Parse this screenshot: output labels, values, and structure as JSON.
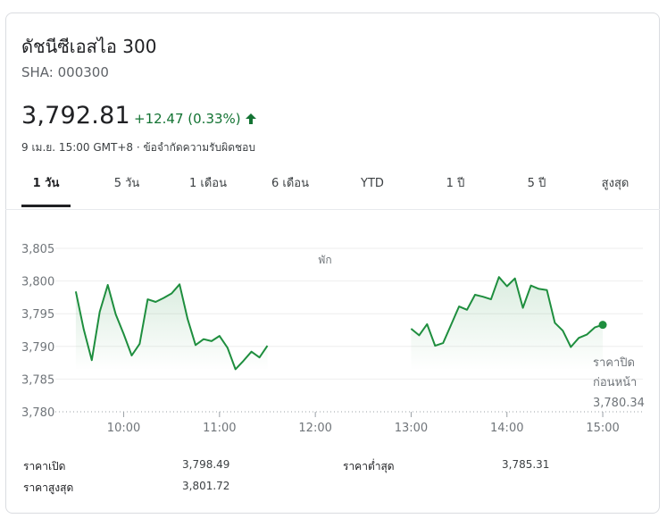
{
  "header": {
    "title": "ดัชนีซีเอสไอ 300",
    "ticker": "SHA: 000300",
    "price": "3,792.81",
    "change": "+12.47 (0.33%)",
    "timestamp": "9 เม.ย. 15:00 GMT+8 · ข้อจำกัดความรับผิดชอบ",
    "up_color": "#137333"
  },
  "tabs": [
    {
      "label": "1 วัน",
      "active": true
    },
    {
      "label": "5 วัน",
      "active": false
    },
    {
      "label": "1 เดือน",
      "active": false
    },
    {
      "label": "6 เดือน",
      "active": false
    },
    {
      "label": "YTD",
      "active": false
    },
    {
      "label": "1 ปี",
      "active": false
    },
    {
      "label": "5 ปี",
      "active": false
    },
    {
      "label": "สูงสุด",
      "active": false
    }
  ],
  "chart_data": {
    "type": "area",
    "title": "",
    "xlabel": "",
    "ylabel": "",
    "ylim": [
      3780,
      3806
    ],
    "y_ticks": [
      "3,805",
      "3,800",
      "3,795",
      "3,790",
      "3,785",
      "3,780"
    ],
    "y_tick_values": [
      3805,
      3800,
      3795,
      3790,
      3785,
      3780
    ],
    "x_ticks": [
      "10:00",
      "11:00",
      "12:00",
      "13:00",
      "14:00",
      "15:00"
    ],
    "x_tick_values": [
      600,
      660,
      720,
      780,
      840,
      900
    ],
    "break_label": "พัก",
    "prev_close_label_1": "ราคาปิด",
    "prev_close_label_2": "ก่อนหน้า",
    "prev_close_value": "3,780.34",
    "line_color": "#1e8e3e",
    "series": [
      {
        "segment": "morning",
        "x": [
          570,
          575,
          580,
          585,
          590,
          595,
          600,
          605,
          610,
          615,
          620,
          625,
          630,
          635,
          640,
          645,
          650,
          655,
          660,
          665,
          670,
          675,
          680,
          685,
          690
        ],
        "y": [
          3798.4,
          3792.6,
          3787.9,
          3795.3,
          3799.4,
          3794.9,
          3791.9,
          3788.6,
          3790.4,
          3797.2,
          3796.8,
          3797.4,
          3798.1,
          3799.5,
          3794.2,
          3790.2,
          3791.1,
          3790.8,
          3791.6,
          3789.8,
          3786.5,
          3787.8,
          3789.2,
          3788.3,
          3790.1
        ]
      },
      {
        "segment": "afternoon",
        "x": [
          780,
          785,
          790,
          795,
          800,
          805,
          810,
          815,
          820,
          825,
          830,
          835,
          840,
          845,
          850,
          855,
          860,
          865,
          870,
          875,
          880,
          885,
          890,
          895,
          900
        ],
        "y": [
          3792.7,
          3791.7,
          3793.4,
          3790.1,
          3790.5,
          3793.3,
          3796.1,
          3795.6,
          3797.9,
          3797.6,
          3797.2,
          3800.6,
          3799.2,
          3800.4,
          3795.9,
          3799.3,
          3798.8,
          3798.6,
          3793.6,
          3792.4,
          3789.9,
          3791.3,
          3791.8,
          3792.9,
          3793.3
        ]
      }
    ]
  },
  "stats": [
    {
      "label": "ราคาเปิด",
      "value": "3,798.49"
    },
    {
      "label": "ราคาต่ำสุด",
      "value": "3,785.31"
    },
    {
      "label": "ราคาสูงสุด",
      "value": "3,801.72"
    }
  ]
}
